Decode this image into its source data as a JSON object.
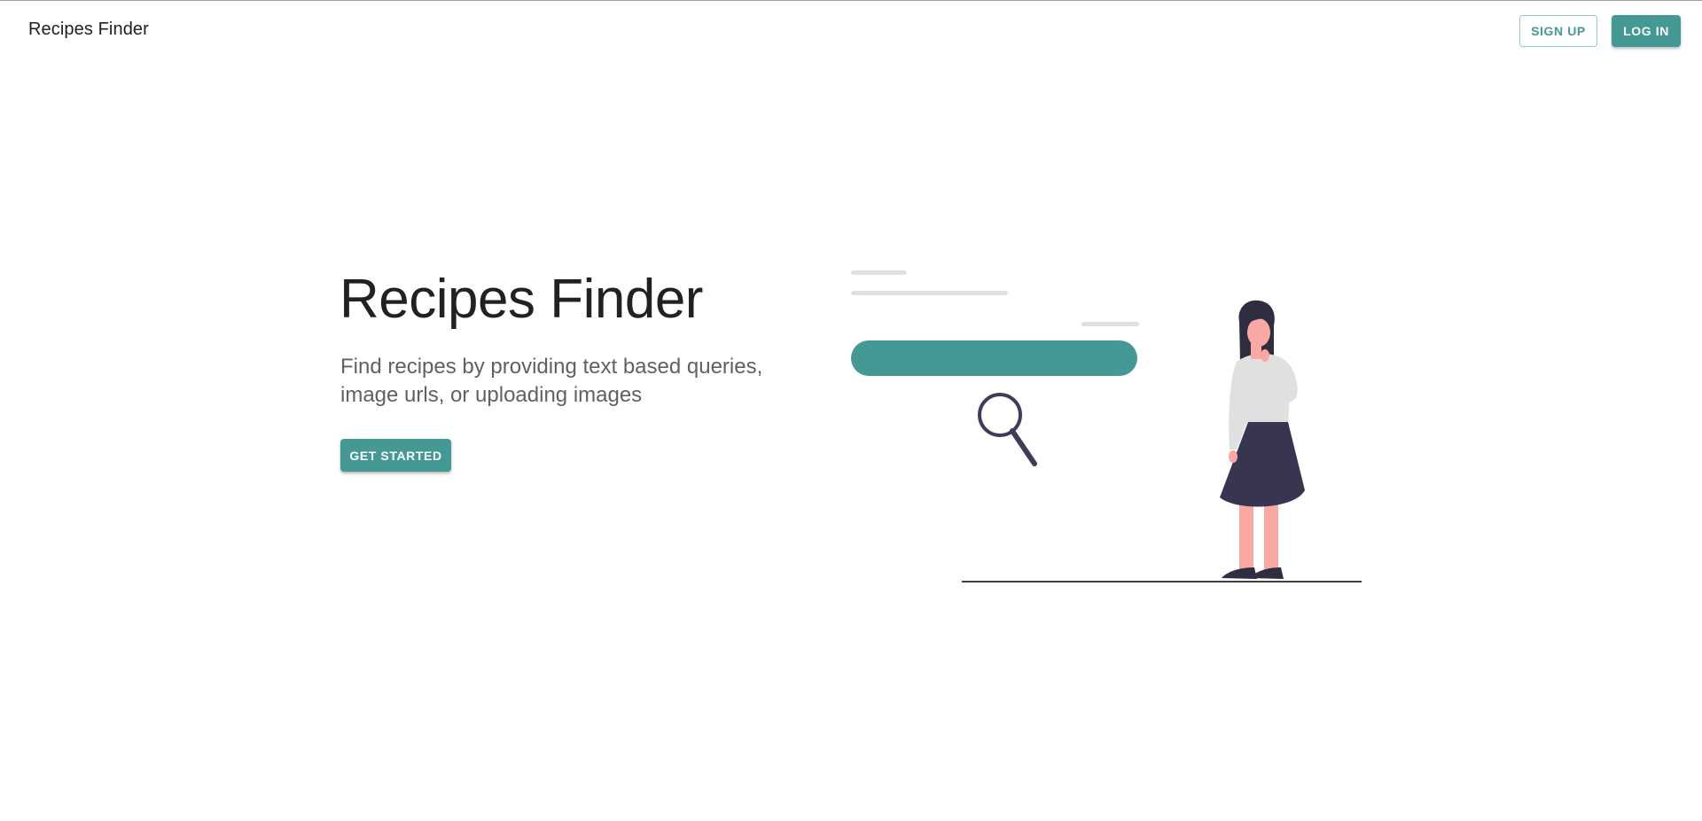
{
  "header": {
    "brand": "Recipes Finder",
    "signup_label": "SIGN UP",
    "login_label": "LOG IN"
  },
  "hero": {
    "title": "Recipes Finder",
    "subtitle": "Find recipes by providing text based queries, image urls, or uploading images",
    "cta_label": "GET STARTED"
  },
  "illustration": {
    "icon": "search-person-illustration",
    "accent_color": "#459994"
  },
  "colors": {
    "accent": "#459994",
    "text_primary": "#212121",
    "text_secondary": "#616161",
    "skirt": "#383551",
    "skin": "#f9a8a4",
    "shirt": "#e0e0e0",
    "line": "#e0e0e0"
  }
}
